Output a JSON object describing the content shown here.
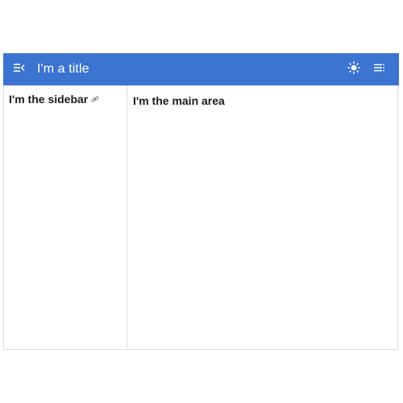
{
  "header": {
    "title": "I'm a title",
    "background_color": "#3b73d1",
    "menu_icon": "menu-collapse-icon",
    "theme_icon": "sun-icon",
    "toc_icon": "toc-list-icon"
  },
  "sidebar": {
    "heading": "I'm the sidebar",
    "heading_link_icon": "link-icon"
  },
  "main": {
    "heading": "I'm the main area"
  }
}
